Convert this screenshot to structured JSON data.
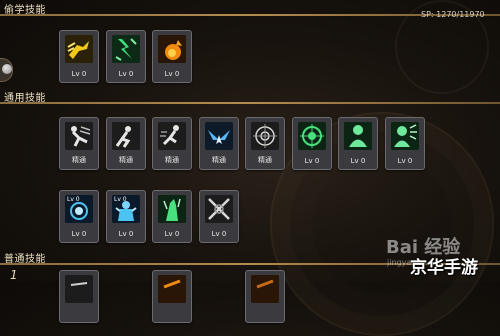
{
  "sections": {
    "steal": "偷学技能",
    "common": "通用技能",
    "normal": "普通技能"
  },
  "sp": "SP: 1270/11970",
  "row_number": "1",
  "steal_skills": [
    {
      "label": "Lv 0",
      "icon": "yellow-kick-icon"
    },
    {
      "label": "Lv 0",
      "icon": "green-lightning-icon"
    },
    {
      "label": "Lv 0",
      "icon": "fire-claw-icon"
    }
  ],
  "common_skills_row1": [
    {
      "label": "精通",
      "icon": "sword-slash-mastery-icon"
    },
    {
      "label": "精通",
      "icon": "crouch-mastery-icon"
    },
    {
      "label": "精通",
      "icon": "dash-mastery-icon"
    },
    {
      "label": "精通",
      "icon": "blue-wings-icon"
    },
    {
      "label": "精通",
      "icon": "target-crosshair-icon"
    },
    {
      "label": "Lv 0",
      "icon": "green-crosshair-icon"
    },
    {
      "label": "Lv 0",
      "icon": "green-figure-icon"
    },
    {
      "label": "Lv 0",
      "icon": "green-shout-icon"
    }
  ],
  "common_skills_row2": [
    {
      "label": "Lv 0",
      "badge": "Lv 0",
      "icon": "blue-ring-icon"
    },
    {
      "label": "Lv 0",
      "badge": "Lv 0",
      "icon": "blue-armor-icon"
    },
    {
      "label": "Lv 0",
      "icon": "green-figure-aura-icon"
    },
    {
      "label": "Lv 0",
      "icon": "gray-crossed-blades-icon"
    }
  ],
  "watermark": {
    "brand": "Bai 经验",
    "domain": "jingyan",
    "site": "京华手游"
  }
}
